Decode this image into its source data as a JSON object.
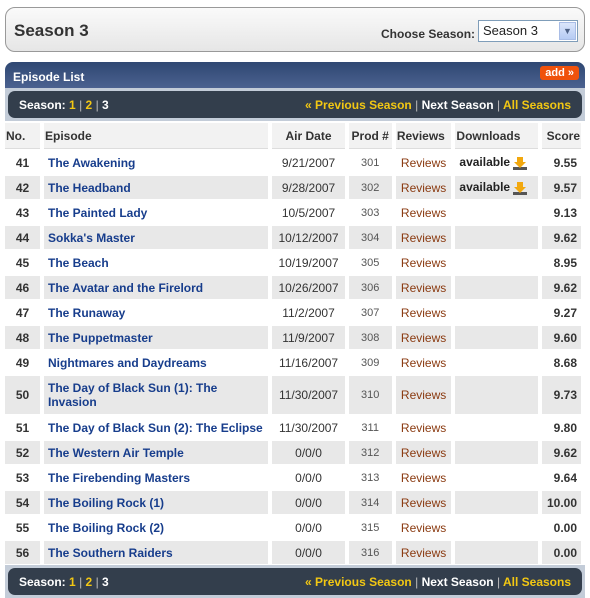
{
  "header": {
    "title": "Season 3",
    "choose_label": "Choose Season:",
    "selected_season": "Season 3"
  },
  "panel": {
    "title": "Episode List",
    "add_label": "add »"
  },
  "nav": {
    "season_label": "Season:",
    "seasons": [
      "1",
      "2",
      "3"
    ],
    "prev": "« Previous Season",
    "next": "Next Season",
    "all": "All Seasons"
  },
  "columns": [
    "No.",
    "Episode",
    "Air Date",
    "Prod #",
    "Reviews",
    "Downloads",
    "Score"
  ],
  "episodes": [
    {
      "no": "41",
      "title": "The Awakening",
      "date": "9/21/2007",
      "prod": "301",
      "reviews": "Reviews",
      "download": "available",
      "score": "9.55"
    },
    {
      "no": "42",
      "title": "The Headband",
      "date": "9/28/2007",
      "prod": "302",
      "reviews": "Reviews",
      "download": "available",
      "score": "9.57"
    },
    {
      "no": "43",
      "title": "The Painted Lady",
      "date": "10/5/2007",
      "prod": "303",
      "reviews": "Reviews",
      "download": "",
      "score": "9.13"
    },
    {
      "no": "44",
      "title": "Sokka's Master",
      "date": "10/12/2007",
      "prod": "304",
      "reviews": "Reviews",
      "download": "",
      "score": "9.62"
    },
    {
      "no": "45",
      "title": "The Beach",
      "date": "10/19/2007",
      "prod": "305",
      "reviews": "Reviews",
      "download": "",
      "score": "8.95"
    },
    {
      "no": "46",
      "title": "The Avatar and the Firelord",
      "date": "10/26/2007",
      "prod": "306",
      "reviews": "Reviews",
      "download": "",
      "score": "9.62"
    },
    {
      "no": "47",
      "title": "The Runaway",
      "date": "11/2/2007",
      "prod": "307",
      "reviews": "Reviews",
      "download": "",
      "score": "9.27"
    },
    {
      "no": "48",
      "title": "The Puppetmaster",
      "date": "11/9/2007",
      "prod": "308",
      "reviews": "Reviews",
      "download": "",
      "score": "9.60"
    },
    {
      "no": "49",
      "title": "Nightmares and Daydreams",
      "date": "11/16/2007",
      "prod": "309",
      "reviews": "Reviews",
      "download": "",
      "score": "8.68"
    },
    {
      "no": "50",
      "title": "The Day of Black Sun (1): The Invasion",
      "date": "11/30/2007",
      "prod": "310",
      "reviews": "Reviews",
      "download": "",
      "score": "9.73"
    },
    {
      "no": "51",
      "title": "The Day of Black Sun (2): The Eclipse",
      "date": "11/30/2007",
      "prod": "311",
      "reviews": "Reviews",
      "download": "",
      "score": "9.80"
    },
    {
      "no": "52",
      "title": "The Western Air Temple",
      "date": "0/0/0",
      "prod": "312",
      "reviews": "Reviews",
      "download": "",
      "score": "9.62"
    },
    {
      "no": "53",
      "title": "The Firebending Masters",
      "date": "0/0/0",
      "prod": "313",
      "reviews": "Reviews",
      "download": "",
      "score": "9.64"
    },
    {
      "no": "54",
      "title": "The Boiling Rock (1)",
      "date": "0/0/0",
      "prod": "314",
      "reviews": "Reviews",
      "download": "",
      "score": "10.00"
    },
    {
      "no": "55",
      "title": "The Boiling Rock (2)",
      "date": "0/0/0",
      "prod": "315",
      "reviews": "Reviews",
      "download": "",
      "score": "0.00"
    },
    {
      "no": "56",
      "title": "The Southern Raiders",
      "date": "0/0/0",
      "prod": "316",
      "reviews": "Reviews",
      "download": "",
      "score": "0.00"
    }
  ]
}
